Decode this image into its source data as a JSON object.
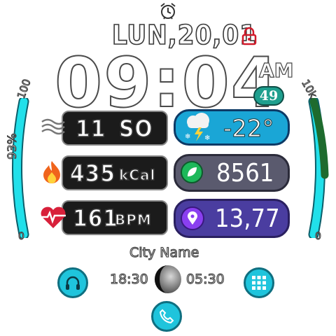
{
  "date": "LUN,20,01",
  "time": {
    "hours": "09",
    "minutes": "04",
    "ampm": "AM",
    "seconds": "49"
  },
  "battery": {
    "label_top": "100",
    "label_bottom": "0",
    "percent_text": "93%",
    "level": 0.93
  },
  "steps_goal": {
    "label_top": "10k",
    "label_bottom": "0",
    "level": 0.85
  },
  "wind": {
    "value": "11",
    "dir": "SO"
  },
  "calories": {
    "value": "435",
    "unit": "kCal"
  },
  "heart": {
    "value": "161",
    "unit": "BPM"
  },
  "weather": {
    "temp": "-22°"
  },
  "steps": {
    "value": "8561"
  },
  "distance": {
    "value": "13,77"
  },
  "city": "City Name",
  "sunrise": "18:30",
  "sunset": "05:30",
  "colors": {
    "accent": "#1fc4dc",
    "green": "#1e6b2e",
    "weather_pill": "#1aa6d6",
    "steps_pill": "#5a5a6e",
    "distance_pill": "#4a3da0"
  },
  "icons": [
    "alarm-icon",
    "lock-icon",
    "wind-icon",
    "flame-icon",
    "heart-pulse-icon",
    "weather-storm-icon",
    "leaf-icon",
    "location-pin-icon",
    "headphones-icon",
    "moon-phase-icon",
    "grid-menu-icon",
    "phone-icon"
  ]
}
